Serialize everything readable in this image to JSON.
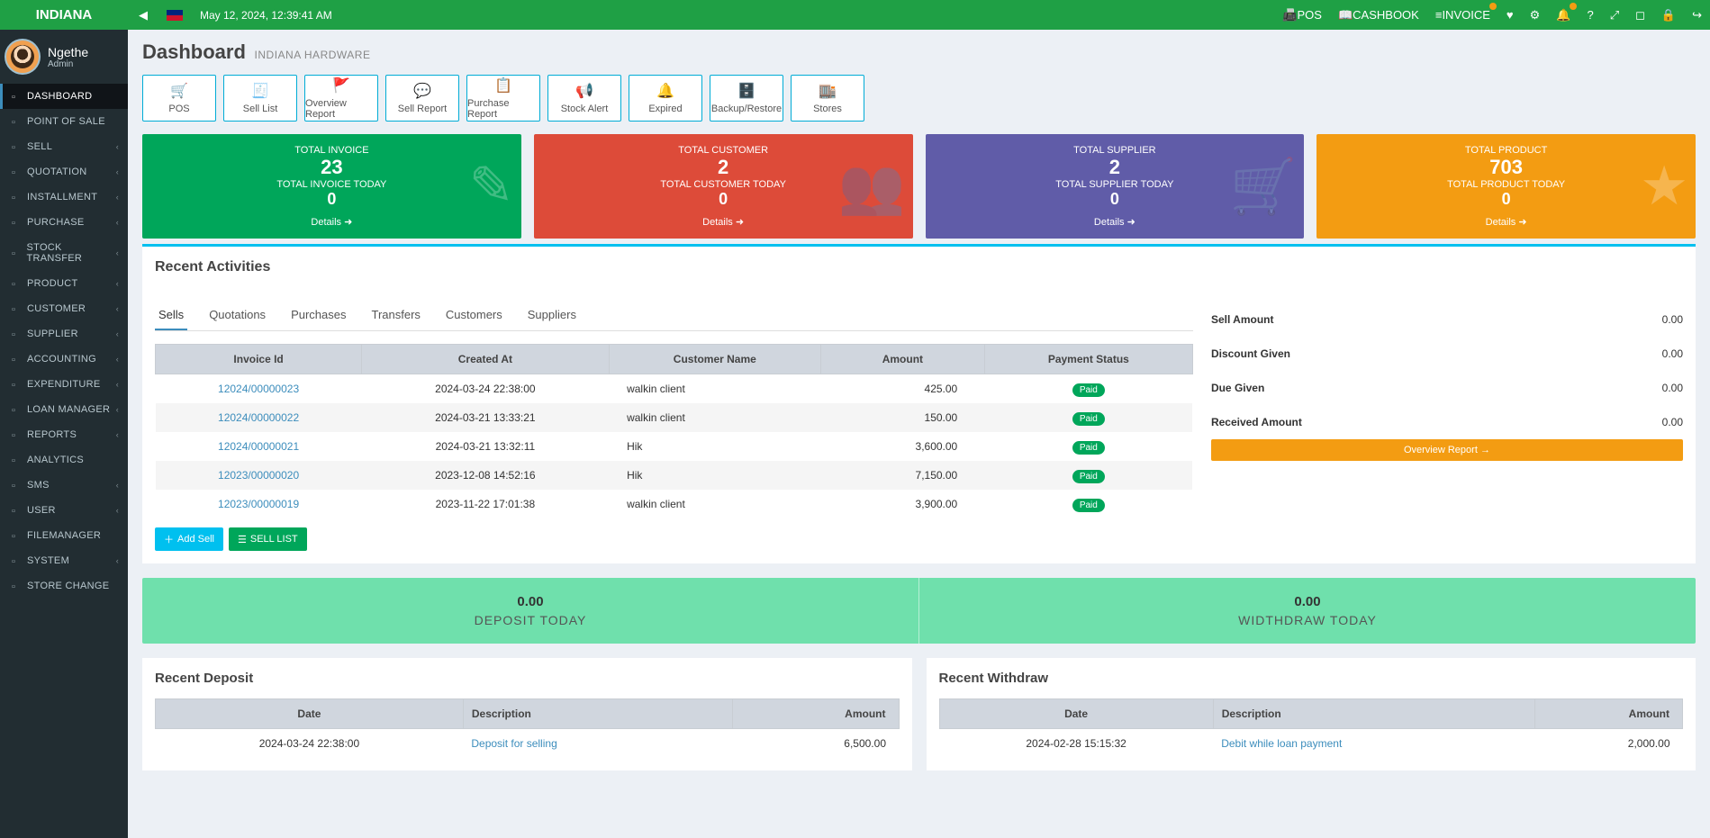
{
  "brand": "INDIANA",
  "datetime": "May 12, 2024, 12:39:41 AM",
  "topbar_links": {
    "pos": "POS",
    "cashbook": "CASHBOOK",
    "invoice": "INVOICE"
  },
  "user": {
    "name": "Ngethe",
    "role": "Admin"
  },
  "nav": [
    {
      "label": "DASHBOARD",
      "active": true
    },
    {
      "label": "POINT OF SALE"
    },
    {
      "label": "SELL",
      "chevron": true
    },
    {
      "label": "QUOTATION",
      "chevron": true
    },
    {
      "label": "INSTALLMENT",
      "chevron": true
    },
    {
      "label": "PURCHASE",
      "chevron": true
    },
    {
      "label": "STOCK TRANSFER",
      "chevron": true
    },
    {
      "label": "PRODUCT",
      "chevron": true
    },
    {
      "label": "CUSTOMER",
      "chevron": true
    },
    {
      "label": "SUPPLIER",
      "chevron": true
    },
    {
      "label": "ACCOUNTING",
      "chevron": true
    },
    {
      "label": "EXPENDITURE",
      "chevron": true
    },
    {
      "label": "LOAN MANAGER",
      "chevron": true
    },
    {
      "label": "REPORTS",
      "chevron": true
    },
    {
      "label": "ANALYTICS"
    },
    {
      "label": "SMS",
      "chevron": true
    },
    {
      "label": "USER",
      "chevron": true
    },
    {
      "label": "FILEMANAGER"
    },
    {
      "label": "SYSTEM",
      "chevron": true
    },
    {
      "label": "STORE CHANGE"
    }
  ],
  "page": {
    "title": "Dashboard",
    "subtitle": "INDIANA HARDWARE"
  },
  "shortcuts": [
    {
      "label": "POS",
      "icon": "🛒"
    },
    {
      "label": "Sell List",
      "icon": "🧾"
    },
    {
      "label": "Overview Report",
      "icon": "🚩"
    },
    {
      "label": "Sell Report",
      "icon": "💬"
    },
    {
      "label": "Purchase Report",
      "icon": "📋"
    },
    {
      "label": "Stock Alert",
      "icon": "📢"
    },
    {
      "label": "Expired",
      "icon": "🔔"
    },
    {
      "label": "Backup/Restore",
      "icon": "🗄️"
    },
    {
      "label": "Stores",
      "icon": "🏬"
    }
  ],
  "stats": [
    {
      "label": "TOTAL INVOICE",
      "value": "23",
      "sub_label": "TOTAL INVOICE TODAY",
      "sub_value": "0",
      "footer": "Details ➜",
      "cls": "stat-green",
      "icon": "✎"
    },
    {
      "label": "TOTAL CUSTOMER",
      "value": "2",
      "sub_label": "TOTAL CUSTOMER TODAY",
      "sub_value": "0",
      "footer": "Details ➜",
      "cls": "stat-red",
      "icon": "👥"
    },
    {
      "label": "TOTAL SUPPLIER",
      "value": "2",
      "sub_label": "TOTAL SUPPLIER TODAY",
      "sub_value": "0",
      "footer": "Details ➜",
      "cls": "stat-purple",
      "icon": "🛒"
    },
    {
      "label": "TOTAL PRODUCT",
      "value": "703",
      "sub_label": "TOTAL PRODUCT TODAY",
      "sub_value": "0",
      "footer": "Details ➜",
      "cls": "stat-orange",
      "icon": "★"
    }
  ],
  "activities": {
    "title": "Recent Activities",
    "tabs": [
      "Sells",
      "Quotations",
      "Purchases",
      "Transfers",
      "Customers",
      "Suppliers"
    ],
    "columns": [
      "Invoice Id",
      "Created At",
      "Customer Name",
      "Amount",
      "Payment Status"
    ],
    "rows": [
      {
        "id": "12024/00000023",
        "date": "2024-03-24 22:38:00",
        "customer": "walkin client",
        "amount": "425.00",
        "status": "Paid"
      },
      {
        "id": "12024/00000022",
        "date": "2024-03-21 13:33:21",
        "customer": "walkin client",
        "amount": "150.00",
        "status": "Paid"
      },
      {
        "id": "12024/00000021",
        "date": "2024-03-21 13:32:11",
        "customer": "Hik",
        "amount": "3,600.00",
        "status": "Paid"
      },
      {
        "id": "12023/00000020",
        "date": "2023-12-08 14:52:16",
        "customer": "Hik",
        "amount": "7,150.00",
        "status": "Paid"
      },
      {
        "id": "12023/00000019",
        "date": "2023-11-22 17:01:38",
        "customer": "walkin client",
        "amount": "3,900.00",
        "status": "Paid"
      }
    ],
    "add_sell": "Add Sell",
    "sell_list": "SELL LIST"
  },
  "summary": [
    {
      "label": "Sell Amount",
      "value": "0.00"
    },
    {
      "label": "Discount Given",
      "value": "0.00"
    },
    {
      "label": "Due Given",
      "value": "0.00"
    },
    {
      "label": "Received Amount",
      "value": "0.00"
    }
  ],
  "overview_btn": "Overview Report →",
  "dw": {
    "deposit_value": "0.00",
    "deposit_label": "DEPOSIT TODAY",
    "withdraw_value": "0.00",
    "withdraw_label": "WIDTHDRAW TODAY"
  },
  "recent_deposit": {
    "title": "Recent Deposit",
    "cols": [
      "Date",
      "Description",
      "Amount"
    ],
    "rows": [
      {
        "date": "2024-03-24 22:38:00",
        "desc": "Deposit for selling",
        "amount": "6,500.00"
      }
    ]
  },
  "recent_withdraw": {
    "title": "Recent Withdraw",
    "cols": [
      "Date",
      "Description",
      "Amount"
    ],
    "rows": [
      {
        "date": "2024-02-28 15:15:32",
        "desc": "Debit while loan payment",
        "amount": "2,000.00"
      }
    ]
  }
}
